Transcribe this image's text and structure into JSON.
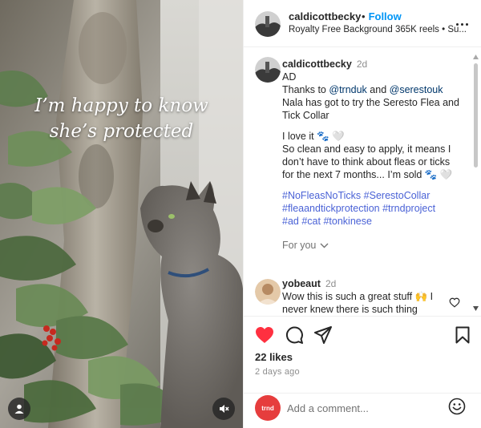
{
  "media": {
    "overlay_lines": [
      "I’m happy to know",
      "she’s protected"
    ],
    "user_tag_icon": "user-tag-icon",
    "mute_icon": "speaker-muted-icon"
  },
  "header": {
    "username": "caldicottbecky",
    "separator": "•",
    "follow_label": "Follow",
    "audio_label": "Royalty Free Background 365K reels • Su...",
    "more_icon": "more-horizontal-icon"
  },
  "caption": {
    "username": "caldicottbecky",
    "time": "2d",
    "lines": [
      {
        "text": "AD"
      },
      {
        "parts": [
          {
            "t": "Thanks to "
          },
          {
            "t": "@trnduk",
            "c": "mention"
          },
          {
            "t": " and "
          },
          {
            "t": "@serestouk",
            "c": "mention"
          }
        ]
      },
      {
        "text": "Nala has got to try the Seresto Flea and"
      },
      {
        "text": "Tick Collar"
      },
      {
        "gap": true
      },
      {
        "text": "I love it 🐾 🤍"
      },
      {
        "text": "So clean and easy to apply, it means I"
      },
      {
        "text": "don’t have to think about fleas or ticks"
      },
      {
        "text": "for the next 7 months... I’m sold 🐾 🤍"
      },
      {
        "gap": true
      },
      {
        "parts": [
          {
            "t": "#NoFleasNoTicks",
            "c": "hash"
          },
          {
            "t": " "
          },
          {
            "t": "#SerestoCollar",
            "c": "hash"
          }
        ]
      },
      {
        "parts": [
          {
            "t": "#fleaandtickprotection",
            "c": "hash"
          },
          {
            "t": " "
          },
          {
            "t": "#trndproject",
            "c": "hash"
          }
        ]
      },
      {
        "parts": [
          {
            "t": "#ad",
            "c": "hash"
          },
          {
            "t": " "
          },
          {
            "t": "#cat",
            "c": "hash"
          },
          {
            "t": " "
          },
          {
            "t": "#tonkinese",
            "c": "hash"
          }
        ]
      }
    ],
    "for_you_label": "For you"
  },
  "comment": {
    "username": "yobeaut",
    "time": "2d",
    "line1": "Wow this is such a great stuff 🙌 I",
    "line2": "never knew there is such thing"
  },
  "actions": {
    "likes": "22 likes",
    "time_ago": "2 days ago",
    "liked": true,
    "like_color": "#ff3040"
  },
  "add_comment": {
    "avatar_label": "trnd",
    "placeholder": "Add a comment...",
    "emoji_icon": "emoji-smiley-icon"
  },
  "colors": {
    "follow": "#0095f6",
    "mention": "#00376b",
    "hashtag": "#4a62d6",
    "trnd": "#e63d3d"
  }
}
